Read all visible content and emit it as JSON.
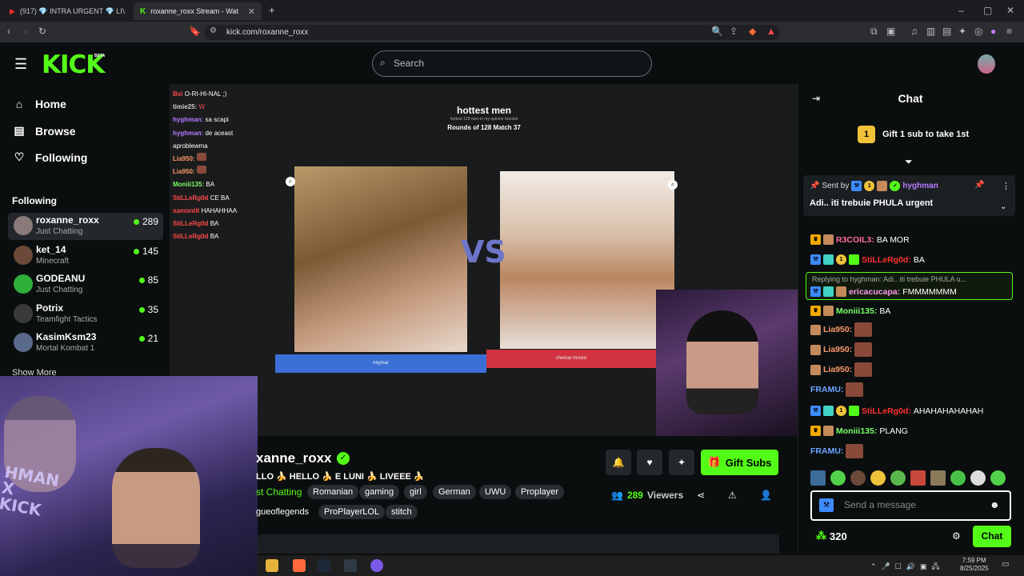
{
  "browser": {
    "tabs": [
      {
        "label": "(917) 💎 INTRA URGENT 💎 LIVEUL"
      },
      {
        "label": "roxanne_roxx Stream - Watch"
      }
    ],
    "new_tab": "+",
    "url": "kick.com/roxanne_roxx"
  },
  "header": {
    "logo": "KICK",
    "beta": "BETA",
    "search_placeholder": "Search"
  },
  "sidebar": {
    "nav": [
      {
        "label": "Home",
        "icon": "home-icon"
      },
      {
        "label": "Browse",
        "icon": "browse-icon"
      },
      {
        "label": "Following",
        "icon": "heart-icon"
      }
    ],
    "following_heading": "Following",
    "following": [
      {
        "name": "roxanne_roxx",
        "category": "Just Chatting",
        "viewers": "289",
        "color": "#8a7a7a"
      },
      {
        "name": "ket_14",
        "category": "Minecraft",
        "viewers": "145",
        "color": "#6b4a3a"
      },
      {
        "name": "GODEANU",
        "category": "Just Chatting",
        "viewers": "85",
        "color": "#2fae3a"
      },
      {
        "name": "Potrix",
        "category": "Teamfight Tactics",
        "viewers": "35",
        "color": "#3a3a3a"
      },
      {
        "name": "KasimKsm23",
        "category": "Mortal Kombat 1",
        "viewers": "21",
        "color": "#5a6a8a"
      }
    ],
    "show_more": "Show More"
  },
  "video": {
    "overlay_chat": [
      {
        "user": "Bsi",
        "text": "O-RI-HI-NAL ;)",
        "color": "#ff4a4a"
      },
      {
        "user": "timie25:",
        "text": "W",
        "color": "#cfcfcf"
      },
      {
        "user": "hyghman:",
        "text": "sa scapi",
        "color": "#b57bff"
      },
      {
        "user": "hyghman:",
        "text": "de aceast",
        "color": "#b57bff"
      },
      {
        "user": "",
        "text": "aproblewma",
        "color": "#ffffff"
      },
      {
        "user": "Lia950:",
        "text": "",
        "color": "#ff9b6b"
      },
      {
        "user": "Lia950:",
        "text": "",
        "color": "#ff9b6b"
      },
      {
        "user": "Moniii135:",
        "text": "BA",
        "color": "#7cff6b"
      },
      {
        "user": "StiLLeRg0d",
        "text": "CE BA",
        "color": "#ff4a4a"
      },
      {
        "user": "samontit",
        "text": "HAHAHHAA",
        "color": "#ff4a4a"
      },
      {
        "user": "StiLLeRg0d",
        "text": "BA",
        "color": "#ff4a4a"
      },
      {
        "user": "StiLLeRg0d",
        "text": "BA",
        "color": "#ff4a4a"
      }
    ],
    "bracket_title": "hottest men",
    "bracket_subtitle": "hottest 128 men in my opinion bracket",
    "bracket_round": "Rounds of 128 Match 37",
    "vs": "VS",
    "option_left": "neymar",
    "option_right": "shemar moore",
    "cam_overlay_text": "HMAN\nX\nKICK"
  },
  "stream": {
    "channel": "xanne_roxx",
    "title": "LLO 🍌 HELLO 🍌 E LUNI 🍌 LIVEEE 🍌",
    "category": "st Chatting",
    "tags_row1": [
      "Romanian",
      "gaming",
      "girl",
      "German",
      "UWU",
      "Proplayer"
    ],
    "tags_row2": [
      "gueoflegends",
      "ProPlayerLOL",
      "stitch"
    ],
    "gift_subs": "Gift Subs",
    "viewers_count": "289",
    "viewers_label": "Viewers"
  },
  "chat": {
    "title": "Chat",
    "gift_badge": "1",
    "gift_text": "Gift 1 sub to take 1st",
    "pinned_sent_by": "Sent by",
    "pinned_user": "hyghman",
    "pinned_message": "Adi.. iti trebuie PHULA urgent",
    "reply_head": "Replying to hyghman: Adi.. iti trebuie PHULA u...",
    "messages": [
      {
        "user": "R3COIL3:",
        "text": "BA MOR",
        "color": "#ff6b9d"
      },
      {
        "user": "StiLLeRg0d:",
        "text": "BA",
        "color": "#ff3030"
      },
      {
        "user": "ericacucapa:",
        "text": "FMMMMMMM",
        "color": "#ff9bf0"
      },
      {
        "user": "Moniii135:",
        "text": "BA",
        "color": "#7cff6b"
      },
      {
        "user": "Lia950:",
        "text": "",
        "color": "#ff9b6b"
      },
      {
        "user": "Lia950:",
        "text": "",
        "color": "#ff9b6b"
      },
      {
        "user": "Lia950:",
        "text": "",
        "color": "#ff9b6b"
      },
      {
        "user": "FRAMU:",
        "text": "",
        "color": "#6ba7ff"
      },
      {
        "user": "StiLLeRg0d:",
        "text": "AHAHAHAHAHAH",
        "color": "#ff3030"
      },
      {
        "user": "Moniii135:",
        "text": "PLANG",
        "color": "#7cff6b"
      },
      {
        "user": "FRAMU:",
        "text": "",
        "color": "#6ba7ff"
      }
    ],
    "input_placeholder": "Send a message",
    "points": "320",
    "send": "Chat"
  },
  "taskbar": {
    "time": "7:59 PM",
    "date": "8/25/2025"
  },
  "colors": {
    "accent": "#53fc18",
    "background": "#0b0e0f"
  }
}
